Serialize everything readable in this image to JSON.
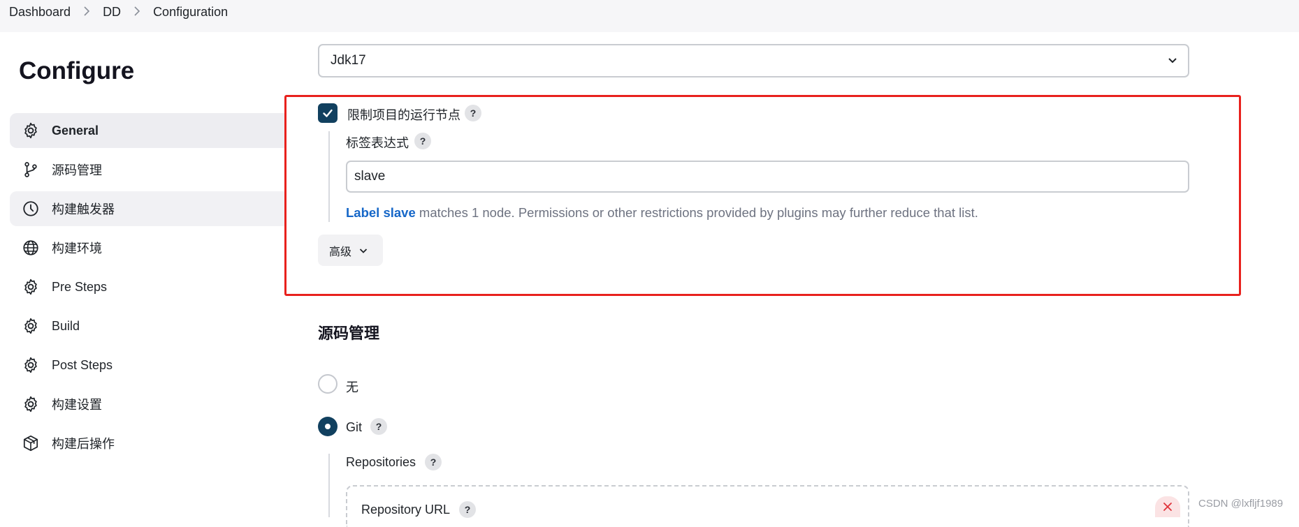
{
  "breadcrumb": {
    "items": [
      "Dashboard",
      "DD",
      "Configuration"
    ]
  },
  "page_title": "Configure",
  "sidebar": {
    "items": [
      {
        "label": "General",
        "icon": "gear-icon"
      },
      {
        "label": "源码管理",
        "icon": "branch-icon"
      },
      {
        "label": "构建触发器",
        "icon": "clock-icon"
      },
      {
        "label": "构建环境",
        "icon": "globe-icon"
      },
      {
        "label": "Pre Steps",
        "icon": "gear-icon"
      },
      {
        "label": "Build",
        "icon": "gear-icon"
      },
      {
        "label": "Post Steps",
        "icon": "gear-icon"
      },
      {
        "label": "构建设置",
        "icon": "gear-icon"
      },
      {
        "label": "构建后操作",
        "icon": "package-icon"
      }
    ]
  },
  "jdk_select": {
    "value": "Jdk17"
  },
  "restrict_node": {
    "label": "限制项目的运行节点",
    "checked": true,
    "help": "?",
    "expression_label": "标签表达式",
    "expression_help": "?",
    "expression_value": "slave",
    "match_link": "Label slave",
    "match_text": " matches 1 node. Permissions or other restrictions provided by plugins may further reduce that list.",
    "advanced_label": "高级"
  },
  "scm_section": {
    "title": "源码管理",
    "options": [
      {
        "label": "无",
        "selected": false
      },
      {
        "label": "Git",
        "selected": true,
        "help": "?"
      }
    ],
    "repositories_label": "Repositories",
    "repositories_help": "?",
    "repository_url_label": "Repository URL",
    "repository_url_help": "?"
  },
  "watermark": "CSDN @lxfljf1989",
  "colors": {
    "accent": "#11405f",
    "link": "#1667c8",
    "highlight_border": "#e8211d",
    "remove": "#e0323a"
  }
}
